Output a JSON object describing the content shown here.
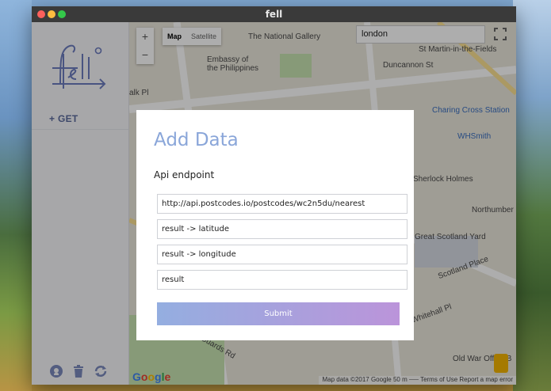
{
  "window": {
    "title": "fell"
  },
  "sidebar": {
    "get_label": "+ GET",
    "footer_icons": [
      "github-icon",
      "trash-icon",
      "refresh-icon"
    ]
  },
  "map": {
    "zoom_in": "+",
    "zoom_out": "−",
    "map_type": {
      "map": "Map",
      "satellite": "Satellite"
    },
    "search_value": "london",
    "labels": {
      "national_gallery": "The National Gallery",
      "embassy": "Embassy of",
      "embassy2": "the Philippines",
      "martin": "St Martin-in-the-Fields",
      "duncannon": "Duncannon St",
      "charing": "Charing Cross Station",
      "whsmith": "WHSmith",
      "sherlock": "Sherlock Holmes",
      "northumber": "Northumber",
      "scotland_yard": "Great Scotland Yard",
      "scotland_place": "Scotland Place",
      "whitehall_pl": "Whitehall Pl",
      "horse_guards": "Horse Guards Rd",
      "war_office": "Old War Office B",
      "walk_pl": "alk Pl"
    },
    "attribution": "Map data ©2017 Google   50 m ⎯⎯⎯   Terms of Use   Report a map error",
    "google": "Google"
  },
  "modal": {
    "title": "Add Data",
    "label": "Api endpoint",
    "fields": [
      "http://api.postcodes.io/postcodes/wc2n5du/nearest",
      "result -> latitude",
      "result -> longitude",
      "result"
    ],
    "submit": "Submit"
  },
  "colors": {
    "accent": "#8aa6d9",
    "submit_gradient_start": "#94aee0",
    "submit_gradient_end": "#bb94da"
  }
}
